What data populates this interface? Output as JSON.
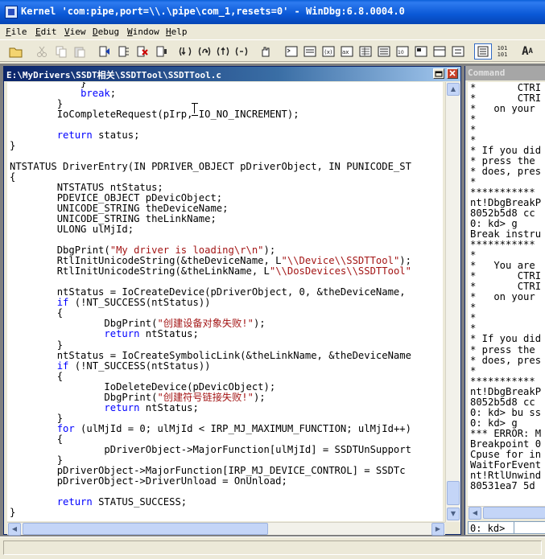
{
  "window": {
    "title": "Kernel 'com:pipe,port=\\\\.\\pipe\\com_1,resets=0' - WinDbg:6.8.0004.0"
  },
  "menu": [
    {
      "acc": "F",
      "rest": "ile"
    },
    {
      "acc": "E",
      "rest": "dit"
    },
    {
      "acc": "V",
      "rest": "iew"
    },
    {
      "acc": "D",
      "rest": "ebug"
    },
    {
      "acc": "W",
      "rest": "indow"
    },
    {
      "acc": "H",
      "rest": "elp"
    }
  ],
  "toolbar": {
    "font_size_label": "A",
    "font_size_small": "A",
    "source_mode_label": "101\n101"
  },
  "source_window": {
    "title": "E:\\MyDrivers\\SSDT相关\\SSDTTool\\SSDTTool.c",
    "lines": [
      "            }",
      "            break;",
      "        }",
      "        IoCompleteRequest(pIrp, IO_NO_INCREMENT);",
      "",
      "        return status;",
      "}",
      "",
      "NTSTATUS DriverEntry(IN PDRIVER_OBJECT pDriverObject, IN PUNICODE_ST",
      "{",
      "        NTSTATUS ntStatus;",
      "        PDEVICE_OBJECT pDevicObject;",
      "        UNICODE_STRING theDeviceName;",
      "        UNICODE_STRING theLinkName;",
      "        ULONG ulMjId;",
      "",
      "        DbgPrint(\"My driver is loading\\r\\n\");",
      "        RtlInitUnicodeString(&theDeviceName, L\"\\\\Device\\\\SSDTTool\");",
      "        RtlInitUnicodeString(&theLinkName, L\"\\\\DosDevices\\\\SSDTTool\"",
      "",
      "        ntStatus = IoCreateDevice(pDriverObject, 0, &theDeviceName,",
      "        if (!NT_SUCCESS(ntStatus))",
      "        {",
      "                DbgPrint(\"创建设备对象失败!\");",
      "                return ntStatus;",
      "        }",
      "        ntStatus = IoCreateSymbolicLink(&theLinkName, &theDeviceName",
      "        if (!NT_SUCCESS(ntStatus))",
      "        {",
      "                IoDeleteDevice(pDevicObject);",
      "                DbgPrint(\"创建符号链接失败!\");",
      "                return ntStatus;",
      "        }",
      "        for (ulMjId = 0; ulMjId < IRP_MJ_MAXIMUM_FUNCTION; ulMjId++)",
      "        {",
      "                pDriverObject->MajorFunction[ulMjId] = SSDTUnSupport",
      "        }",
      "        pDriverObject->MajorFunction[IRP_MJ_DEVICE_CONTROL] = SSDTc",
      "        pDriverObject->DriverUnload = OnUnload;",
      "",
      "        return STATUS_SUCCESS;",
      "}"
    ]
  },
  "command_window": {
    "title": "Command",
    "lines": [
      "*       CTRI",
      "*       CTRI",
      "*   on your",
      "*",
      "*",
      "*",
      "* If you did",
      "* press the",
      "* does, pres",
      "*",
      "***********",
      "nt!DbgBreakP",
      "8052b5d8 cc",
      "0: kd> g",
      "Break instru",
      "***********",
      "*",
      "*   You are",
      "*       CTRI",
      "*       CTRI",
      "*   on your",
      "*",
      "*",
      "*",
      "* If you did",
      "* press the",
      "* does, pres",
      "*",
      "***********",
      "nt!DbgBreakP",
      "8052b5d8 cc",
      "0: kd> bu ss",
      "0: kd> g",
      "*** ERROR: M",
      "Breakpoint 0",
      "Cpuse for in",
      "WaitForEvent",
      "nt!RtlUnwind",
      "80531ea7 5d"
    ],
    "prompt": "0: kd>"
  }
}
